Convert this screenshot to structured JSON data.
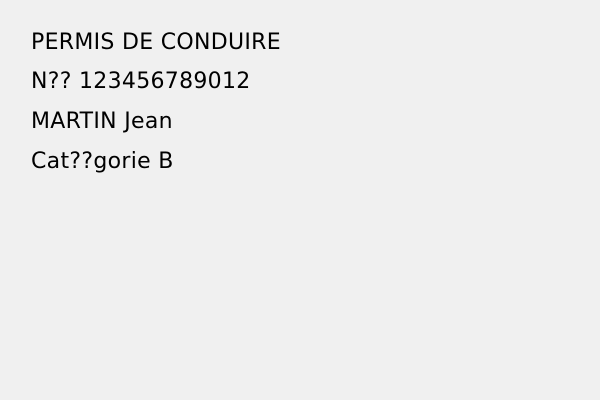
{
  "document": {
    "title": "PERMIS DE CONDUIRE",
    "number_line": "N?? 123456789012",
    "name_line": "MARTIN Jean",
    "category_line": "Cat??gorie B"
  },
  "colors": {
    "background": "#f0f0f0",
    "text": "#000000"
  }
}
